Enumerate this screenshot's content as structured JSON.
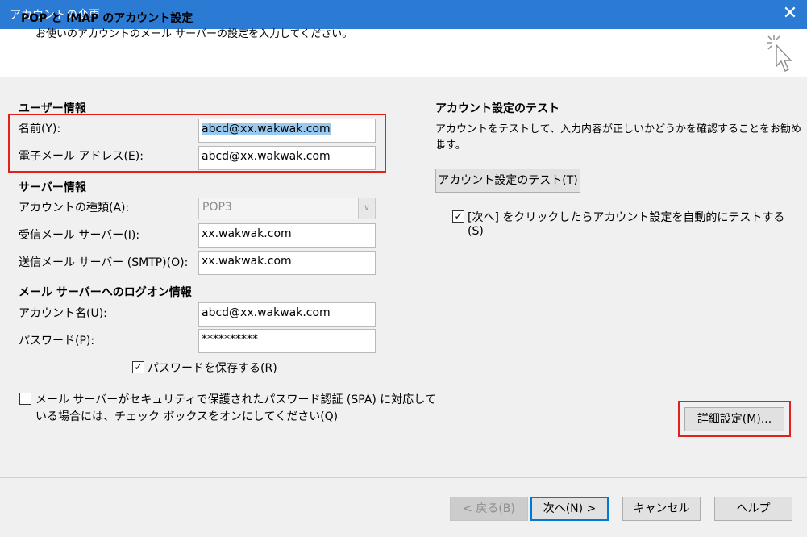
{
  "window": {
    "title": "アカウントの変更",
    "close_glyph": "✕"
  },
  "header": {
    "title": "POP と IMAP のアカウント設定",
    "subtitle": "お使いのアカウントのメール サーバーの設定を入力してください。"
  },
  "user_info": {
    "heading": "ユーザー情報",
    "name_label": "名前(Y):",
    "name_value": "abcd@xx.wakwak.com",
    "email_label": "電子メール アドレス(E):",
    "email_value": "abcd@xx.wakwak.com"
  },
  "server_info": {
    "heading": "サーバー情報",
    "account_type_label": "アカウントの種類(A):",
    "account_type_value": "POP3",
    "incoming_label": "受信メール サーバー(I):",
    "incoming_value": "xx.wakwak.com",
    "outgoing_label": "送信メール サーバー (SMTP)(O):",
    "outgoing_value": "xx.wakwak.com"
  },
  "logon_info": {
    "heading": "メール サーバーへのログオン情報",
    "account_name_label": "アカウント名(U):",
    "account_name_value": "abcd@xx.wakwak.com",
    "password_label": "パスワード(P):",
    "password_value": "**********",
    "save_password_label": "パスワードを保存する(R)",
    "save_password_checked": true,
    "spa_line1": "メール サーバーがセキュリティで保護されたパスワード認証 (SPA) に対応して",
    "spa_line2": "いる場合には、チェック ボックスをオンにしてください(Q)",
    "spa_checked": false
  },
  "test_section": {
    "heading": "アカウント設定のテスト",
    "desc_line1": "アカウントをテストして、入力内容が正しいかどうかを確認することをお勧めし",
    "desc_line2": "ます。",
    "test_button": "アカウント設定のテスト(T)",
    "auto_test_line1": "[次へ] をクリックしたらアカウント設定を自動的にテストする",
    "auto_test_line2": "(S)",
    "auto_test_checked": true
  },
  "advanced_button": "詳細設定(M)...",
  "footer": {
    "back": "< 戻る(B)",
    "next": "次へ(N) >",
    "cancel": "キャンセル",
    "help": "ヘルプ"
  },
  "icons": {
    "checkmark": "✓",
    "combo_arrow": "∨"
  },
  "colors": {
    "titlebar": "#2b7bd4",
    "highlight_box": "#e2211c",
    "default_button_border": "#0078d7"
  }
}
